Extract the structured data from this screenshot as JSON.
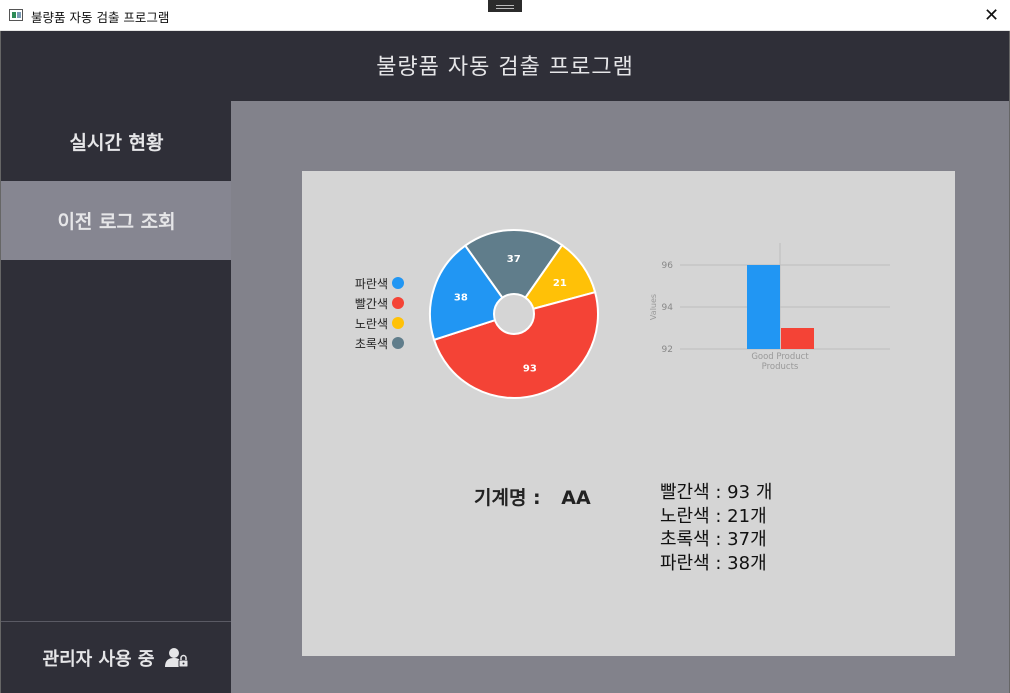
{
  "window": {
    "title": "불량품 자동 검출 프로그램",
    "close_icon": "close-icon"
  },
  "header": {
    "title": "불량품 자동 검출 프로그램"
  },
  "sidebar": {
    "items": [
      {
        "label": "실시간 현황",
        "active": false
      },
      {
        "label": "이전 로그 조회",
        "active": true
      }
    ],
    "admin": {
      "label": "관리자 사용 중",
      "icon": "admin-user-lock-icon"
    }
  },
  "colors": {
    "blue": "#2196f3",
    "red": "#f44336",
    "yellow": "#ffc107",
    "green": "#607d8b",
    "panel": "#d5d5d5",
    "sidebar": "#2f2f38",
    "main_bg": "#82828b"
  },
  "legend": [
    {
      "label": "파란색",
      "color": "#2196f3"
    },
    {
      "label": "빨간색",
      "color": "#f44336"
    },
    {
      "label": "노란색",
      "color": "#ffc107"
    },
    {
      "label": "초록색",
      "color": "#607d8b"
    }
  ],
  "chart_data": [
    {
      "type": "pie",
      "slices": [
        {
          "name": "초록색",
          "value": 37,
          "color": "#607d8b"
        },
        {
          "name": "노란색",
          "value": 21,
          "color": "#ffc107"
        },
        {
          "name": "빨간색",
          "value": 93,
          "color": "#f44336"
        },
        {
          "name": "파란색",
          "value": 38,
          "color": "#2196f3"
        }
      ],
      "legend": "left"
    },
    {
      "type": "bar",
      "categories": [
        "Good Product"
      ],
      "xlabel": "Products",
      "ylabel": "Values",
      "ylim": [
        92,
        96
      ],
      "yticks": [
        92,
        94,
        96
      ],
      "series": [
        {
          "values": [
            96
          ],
          "color": "#2196f3"
        },
        {
          "values": [
            93
          ],
          "color": "#f44336"
        }
      ],
      "grid": true
    }
  ],
  "info": {
    "machine_label": "기계명 :",
    "machine_value": "AA",
    "counts": [
      "빨간색 : 93 개",
      "노란색 : 21개",
      "초록색 : 37개",
      "파란색 : 38개"
    ]
  }
}
